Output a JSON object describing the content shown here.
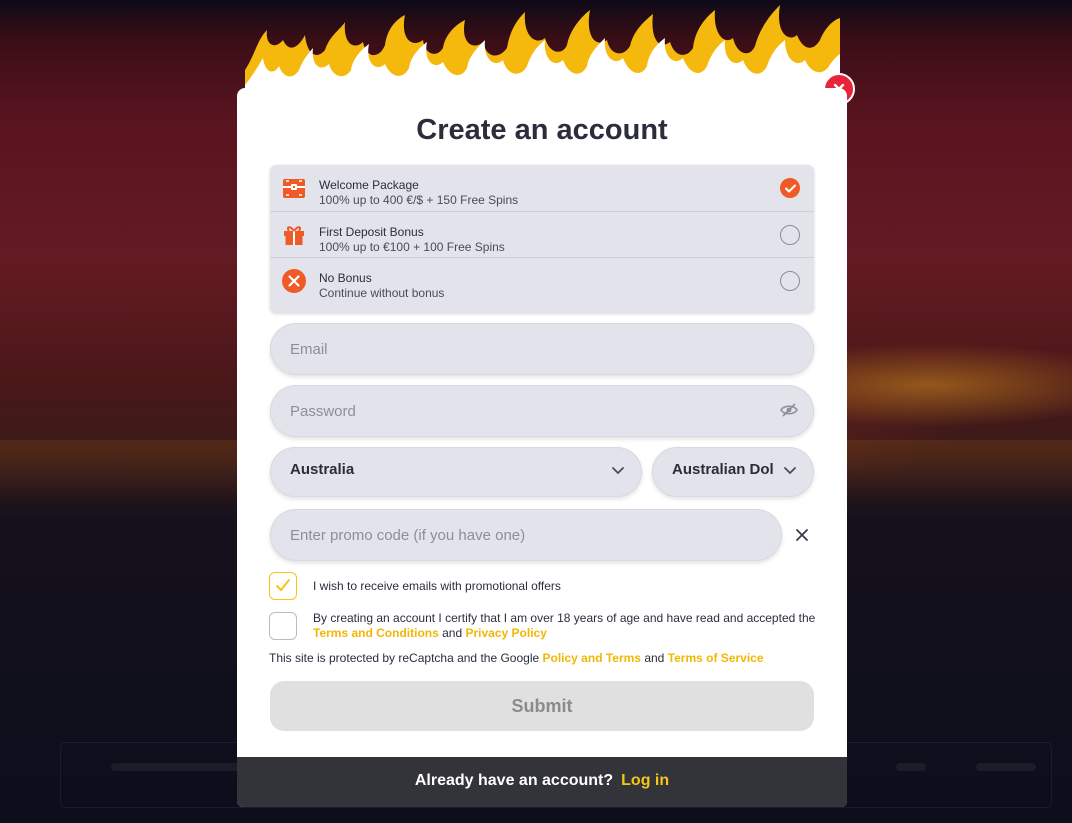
{
  "modal": {
    "title": "Create an account",
    "close_icon": "close-icon",
    "accent_color": "#ef5a26",
    "link_color": "#f2b705"
  },
  "bonuses": [
    {
      "title": "Welcome Package",
      "desc": "100% up to 400 €/$ + 150 Free Spins",
      "icon": "treasure-chest-icon",
      "selected": true
    },
    {
      "title": "First Deposit Bonus",
      "desc": "100% up to €100 + 100 Free Spins",
      "icon": "gift-icon",
      "selected": false
    },
    {
      "title": "No Bonus",
      "desc": "Continue without bonus",
      "icon": "no-bonus-icon",
      "selected": false
    }
  ],
  "form": {
    "email_placeholder": "Email",
    "password_placeholder": "Password",
    "country_value": "Australia",
    "currency_value": "Australian Doll",
    "promo_placeholder": "Enter promo code (if you have one)",
    "promo_checkbox_label": "I wish to receive emails with promotional offers",
    "promo_checkbox_checked": true,
    "terms_text_1": "By creating an account I certify that I am over 18 years of age and have read and accepted the ",
    "terms_link": "Terms and Conditions",
    "terms_and": " and ",
    "privacy_link": "Privacy Policy",
    "terms_checked": false,
    "recaptcha_text_1": "This site is protected by reCaptcha and the Google ",
    "recaptcha_link_1": "Policy and Terms",
    "recaptcha_and": " and ",
    "recaptcha_link_2": "Terms of Service",
    "submit_label": "Submit"
  },
  "footer": {
    "prompt": "Already have an account?",
    "login_label": "Log in"
  }
}
